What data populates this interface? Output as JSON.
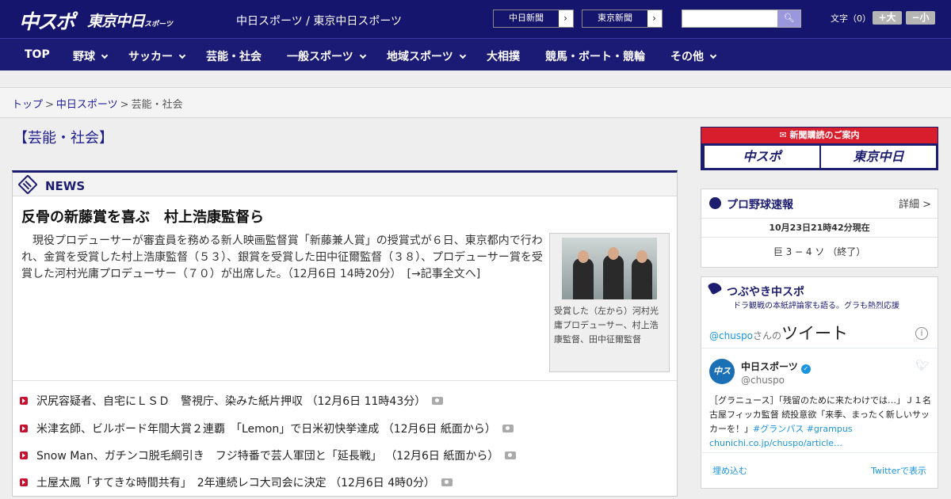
{
  "header": {
    "logo_chuspo": "中スポ",
    "logo_tokyo": "東京中日",
    "logo_tokyo_small": "スポーツ",
    "site_name": "中日スポーツ / 東京中日スポーツ",
    "paper_btn_1": "中日新聞",
    "paper_btn_2": "東京新聞",
    "search_placeholder": "",
    "font_size_label": "文字（0）",
    "font_plus": "+大",
    "font_minus": "−小"
  },
  "nav": {
    "items": [
      "TOP",
      "野球",
      "サッカー",
      "芸能・社会",
      "一般スポーツ",
      "地域スポーツ",
      "大相撲",
      "競馬・ボート・競輪",
      "その他"
    ]
  },
  "breadcrumb": {
    "top": "トップ",
    "sep": ">",
    "chunichi": "中日スポーツ",
    "current": "芸能・社会"
  },
  "page_title": "【芸能・社会】",
  "news": {
    "label": "NEWS",
    "headline": "反骨の新藤賞を喜ぶ　村上浩康監督ら",
    "body": "現役プロデューサーが審査員を務める新人映画監督賞「新藤兼人賞」の授賞式が６日、東京都内で行われ、金賞を受賞した村上浩康監督（５３）、銀賞を受賞した田中征爾監督（３８）、プロデューサー賞を受賞した河村光庸プロデューサー（７０）が出席した。（12月6日 14時20分）　[→記事全文へ]",
    "caption": "受賞した（左から）河村光庸プロデューサー、村上浩康監督、田中征爾監督",
    "list": [
      "沢尻容疑者、自宅にＬＳＤ　警視庁、染みた紙片押収 （12月6日 11時43分）",
      "米津玄師、ビルボード年間大賞２連覇　「Lemon」で日米初快挙達成 （12月6日 紙面から）",
      "Snow Man、ガチンコ脱毛綱引き　フジ特番で芸人軍団と「延長戦」 （12月6日 紙面から）",
      "土屋太鳳「すてきな時間共有」　2年連続レコ大司会に決定 （12月6日 4時0分）"
    ]
  },
  "sidebar": {
    "subscription_head": "新聞購読のご案内",
    "sub_btn_1": "中スポ",
    "sub_btn_2": "東京中日",
    "baseball_title": "プロ野球速報",
    "baseball_more": "詳細 >",
    "baseball_time": "10月23日21時42分現在",
    "baseball_score": "巨 3 − 4 ソ （終了）",
    "tw_title": "つぶやき中スポ",
    "tw_sub": "ドラ観戦の本紙評論家も語る。グラも熱烈応援",
    "tw_handle_link": "@chuspo",
    "tw_san": "さんの",
    "tw_tweets": "ツイート",
    "tw_name": "中日スポーツ",
    "tw_handle": "@chuspo",
    "tw_text": "［グラニュース］「残留のために来たわけでは…」Ｊ１名古屋フィッカ監督 続投意欲「来季、まったく新しいサッカーを！」",
    "tw_tags": "#グランパス #grampus",
    "tw_link": "chunichi.co.jp/chuspo/article…",
    "tw_embed": "埋め込む",
    "tw_view": "Twitterで表示"
  },
  "colors": {
    "brand": "#16156e",
    "accent": "#c8102e",
    "twitter": "#1b95e0"
  }
}
